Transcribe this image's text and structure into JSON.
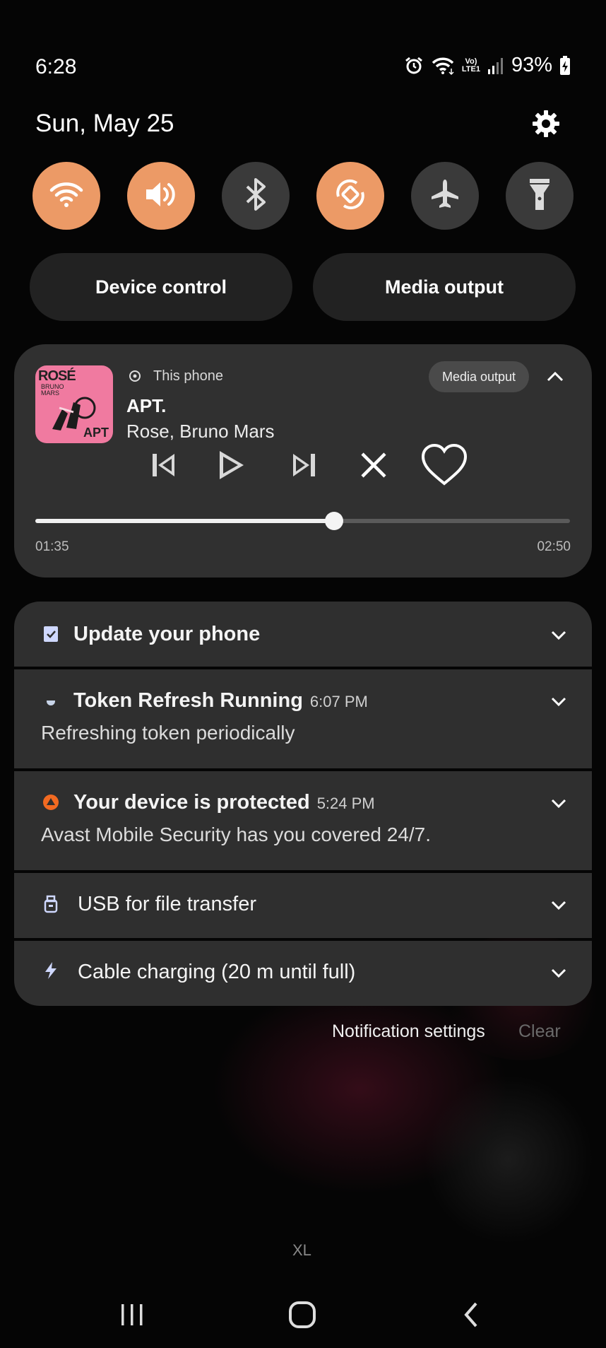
{
  "status_bar": {
    "time": "6:28",
    "network_label_top": "Vo)",
    "network_label_bottom": "LTE1",
    "battery": "93%",
    "icons": [
      "alarm-icon",
      "wifi-icon",
      "volte-icon",
      "signal-icon",
      "battery-charging-icon"
    ]
  },
  "header": {
    "date": "Sun, May 25",
    "settings_icon": "gear-icon"
  },
  "quick_settings": [
    {
      "name": "wifi",
      "icon": "wifi-icon",
      "state": "on"
    },
    {
      "name": "sound",
      "icon": "speaker-icon",
      "state": "on"
    },
    {
      "name": "bluetooth",
      "icon": "bluetooth-icon",
      "state": "off"
    },
    {
      "name": "auto-rotate",
      "icon": "rotate-icon",
      "state": "on"
    },
    {
      "name": "airplane",
      "icon": "airplane-icon",
      "state": "off"
    },
    {
      "name": "flashlight",
      "icon": "flashlight-icon",
      "state": "off"
    }
  ],
  "pills": {
    "device_control": "Device control",
    "media_output": "Media output"
  },
  "media": {
    "album_title": "ROSÉ",
    "album_sub_line1": "BRUNO",
    "album_sub_line2": "MARS",
    "album_apt": "APT",
    "source": "This phone",
    "output_button": "Media output",
    "song": "APT.",
    "artist": "Rose, Bruno Mars",
    "elapsed": "01:35",
    "total": "02:50",
    "progress": 0.559
  },
  "notifications": [
    {
      "title": "Update your phone",
      "time": "",
      "body": "",
      "icon": "system-update-icon"
    },
    {
      "title": "Token Refresh Running",
      "time": "6:07 PM",
      "body": "Refreshing token periodically",
      "icon": "app-dot-icon"
    },
    {
      "title": "Your device is protected",
      "time": "5:24 PM",
      "body": "Avast Mobile Security has you covered 24/7.",
      "icon": "avast-icon"
    },
    {
      "title": "USB for file transfer",
      "time": "",
      "body": "",
      "icon": "usb-icon"
    },
    {
      "title": "Cable charging (20 m until full)",
      "time": "",
      "body": "",
      "icon": "bolt-icon"
    }
  ],
  "footer": {
    "notification_settings": "Notification settings",
    "clear": "Clear",
    "carrier_label": "XL"
  },
  "colors": {
    "accent": "#ec9a66",
    "tile_off": "#3a3a3a",
    "card": "#2f2f2f"
  }
}
